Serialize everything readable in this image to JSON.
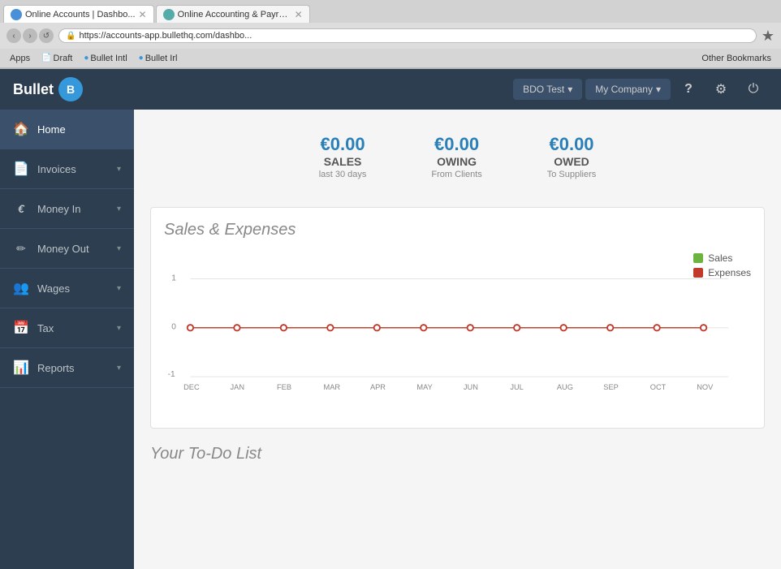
{
  "browser": {
    "tabs": [
      {
        "id": "tab1",
        "favicon_color": "blue",
        "title": "Online Accounts | Dashbo...",
        "active": true
      },
      {
        "id": "tab2",
        "favicon_color": "green",
        "title": "Online Accounting & Payro...",
        "active": false
      }
    ],
    "address": "https://accounts-app.bullethq.com/dashbo...",
    "bookmarks": [
      {
        "id": "bm1",
        "label": "Apps"
      },
      {
        "id": "bm2",
        "label": "Draft"
      },
      {
        "id": "bm3",
        "label": "Bullet Intl"
      },
      {
        "id": "bm4",
        "label": "Bullet Irl"
      }
    ],
    "other_bookmarks": "Other Bookmarks"
  },
  "header": {
    "logo": "Bullet",
    "logo_initial": "B",
    "bdo_test": "BDO Test",
    "my_company": "My Company",
    "help_icon": "?",
    "settings_icon": "⚙",
    "power_icon": "⏻"
  },
  "sidebar": {
    "items": [
      {
        "id": "home",
        "icon": "🏠",
        "label": "Home",
        "active": true,
        "has_arrow": false
      },
      {
        "id": "invoices",
        "icon": "📄",
        "label": "Invoices",
        "active": false,
        "has_arrow": true
      },
      {
        "id": "money-in",
        "icon": "€",
        "label": "Money In",
        "active": false,
        "has_arrow": true
      },
      {
        "id": "money-out",
        "icon": "✏",
        "label": "Money Out",
        "active": false,
        "has_arrow": true
      },
      {
        "id": "wages",
        "icon": "👥",
        "label": "Wages",
        "active": false,
        "has_arrow": true
      },
      {
        "id": "tax",
        "icon": "📅",
        "label": "Tax",
        "active": false,
        "has_arrow": true
      },
      {
        "id": "reports",
        "icon": "📊",
        "label": "Reports",
        "active": false,
        "has_arrow": true
      }
    ]
  },
  "stats": [
    {
      "id": "sales",
      "amount": "€0.00",
      "label": "SALES",
      "sub": "last 30 days"
    },
    {
      "id": "owing",
      "amount": "€0.00",
      "label": "OWING",
      "sub": "From Clients"
    },
    {
      "id": "owed",
      "amount": "€0.00",
      "label": "OWED",
      "sub": "To Suppliers"
    }
  ],
  "chart": {
    "title": "Sales & Expenses",
    "legend": [
      {
        "id": "sales",
        "label": "Sales",
        "color": "sales"
      },
      {
        "id": "expenses",
        "label": "Expenses",
        "color": "expenses"
      }
    ],
    "x_labels": [
      "DEC",
      "JAN",
      "FEB",
      "MAR",
      "APR",
      "MAY",
      "JUN",
      "JUL",
      "AUG",
      "SEP",
      "OCT",
      "NOV"
    ],
    "y_labels": [
      "1",
      "0",
      "-1"
    ],
    "data_points_x": [
      40,
      100,
      161,
      222,
      283,
      344,
      405,
      466,
      527,
      588,
      649,
      710
    ]
  },
  "todo": {
    "title": "Your To-Do List"
  }
}
